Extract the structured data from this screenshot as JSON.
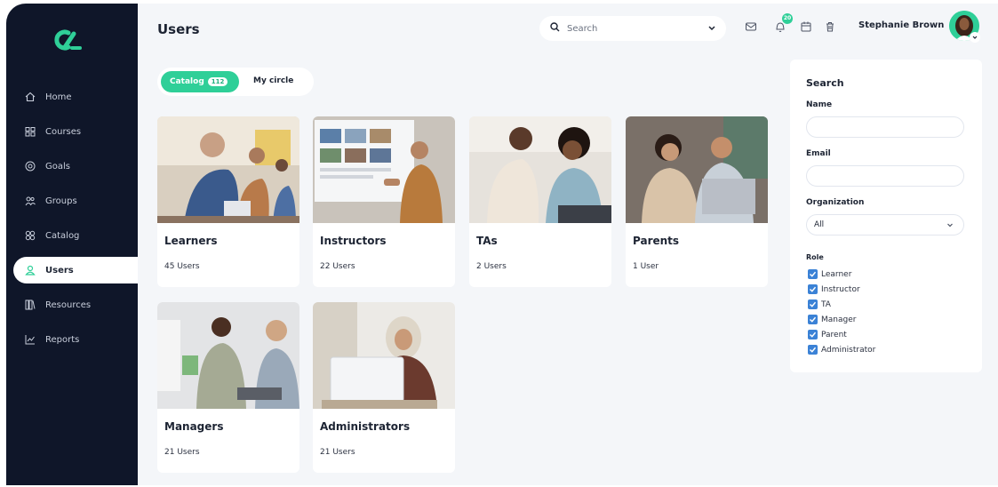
{
  "brand": {
    "accent": "#2fcf98",
    "sidebar_bg": "#0f1629",
    "checkbox": "#3b82d6"
  },
  "sidebar": {
    "items": [
      {
        "label": "Home",
        "icon": "home-icon"
      },
      {
        "label": "Courses",
        "icon": "courses-icon"
      },
      {
        "label": "Goals",
        "icon": "goals-icon"
      },
      {
        "label": "Groups",
        "icon": "groups-icon"
      },
      {
        "label": "Catalog",
        "icon": "catalog-icon"
      },
      {
        "label": "Users",
        "icon": "user-icon",
        "active": true
      },
      {
        "label": "Resources",
        "icon": "resources-icon"
      },
      {
        "label": "Reports",
        "icon": "reports-icon"
      }
    ]
  },
  "header": {
    "title": "Users",
    "search_placeholder": "Search",
    "notification_count": "20",
    "user_name": "Stephanie Brown"
  },
  "tabs": {
    "catalog_label": "Catalog",
    "catalog_count": "112",
    "circle_label": "My circle"
  },
  "cards": [
    {
      "title": "Learners",
      "count": "45 Users"
    },
    {
      "title": "Instructors",
      "count": "22 Users"
    },
    {
      "title": "TAs",
      "count": "2 Users"
    },
    {
      "title": "Parents",
      "count": "1 User"
    },
    {
      "title": "Managers",
      "count": "21 Users"
    },
    {
      "title": "Administrators",
      "count": "21 Users"
    }
  ],
  "filter": {
    "title": "Search",
    "name_label": "Name",
    "email_label": "Email",
    "org_label": "Organization",
    "org_value": "All",
    "role_label": "Role",
    "roles": [
      "Learner",
      "Instructor",
      "TA",
      "Manager",
      "Parent",
      "Administrator"
    ]
  }
}
